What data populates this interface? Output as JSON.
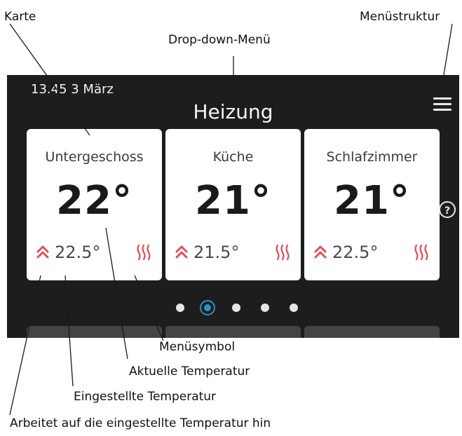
{
  "annotations": {
    "card": "Karte",
    "dropdown_menu": "Drop-down-Menü",
    "menu_structure": "Menüstruktur",
    "menu_symbol": "Menüsymbol",
    "current_temperature": "Aktuelle Temperatur",
    "set_temperature": "Eingestellte Temperatur",
    "working_toward": "Arbeitet auf die eingestellte Temperatur hin"
  },
  "status_bar": {
    "datetime": "13.45 3  März"
  },
  "screen": {
    "title": "Heizung",
    "help": "?"
  },
  "cards": [
    {
      "name": "Untergeschoss",
      "current": "22°",
      "set": "22.5°"
    },
    {
      "name": "Küche",
      "current": "21°",
      "set": "21.5°"
    },
    {
      "name": "Schlafzimmer",
      "current": "21°",
      "set": "22.5°"
    }
  ],
  "pagination": {
    "count": 5,
    "active_index": 1
  },
  "colors": {
    "screen_bg": "#1d1d1d",
    "card_bg": "#ffffff",
    "accent": "#2a91c9",
    "heat": "#e0505a"
  },
  "icons": [
    "hamburger-menu-icon",
    "help-icon",
    "double-chevron-up-icon",
    "heat-waves-icon"
  ]
}
